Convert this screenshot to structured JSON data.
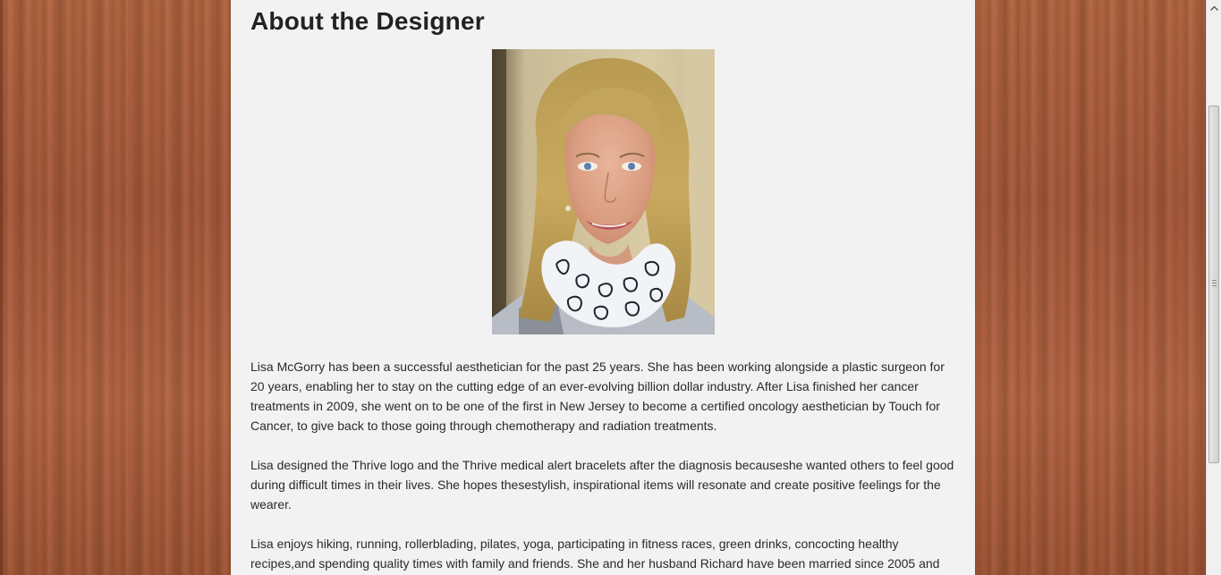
{
  "page": {
    "title": "About the Designer"
  },
  "portrait": {
    "alt": "Photo of Lisa McGorry"
  },
  "bio": {
    "paragraph_1": "Lisa McGorry has been a successful aesthetician for the past 25 years. She has been working alongside a plastic surgeon for 20 years, enabling her to stay on the cutting edge of an ever-evolving billion dollar industry. After Lisa finished her cancer treatments in 2009, she went on to be one of the first in New Jersey to become a certified oncology aesthetician by Touch for Cancer, to give back to those going through chemotherapy and radiation treatments.",
    "paragraph_2": "Lisa designed the Thrive logo and the Thrive medical alert bracelets after the diagnosis becauseshe wanted others to feel good during difficult times in their lives. She hopes thesestylish, inspirational items will resonate and create positive feelings for the wearer.",
    "paragraph_3": "Lisa enjoys hiking, running, rollerblading, pilates, yoga, participating in fitness races, green drinks, concocting healthy recipes,and spending quality times with family and friends. She and her husband Richard have been married since 2005 and"
  },
  "colors": {
    "page_background": "#f2f2f2",
    "wood_background": "#a85a38",
    "text": "#2a2a2a",
    "heading": "#222222"
  },
  "icons": {
    "scroll_up": "chevron-up-icon",
    "scroll_grip": "grip-icon"
  }
}
